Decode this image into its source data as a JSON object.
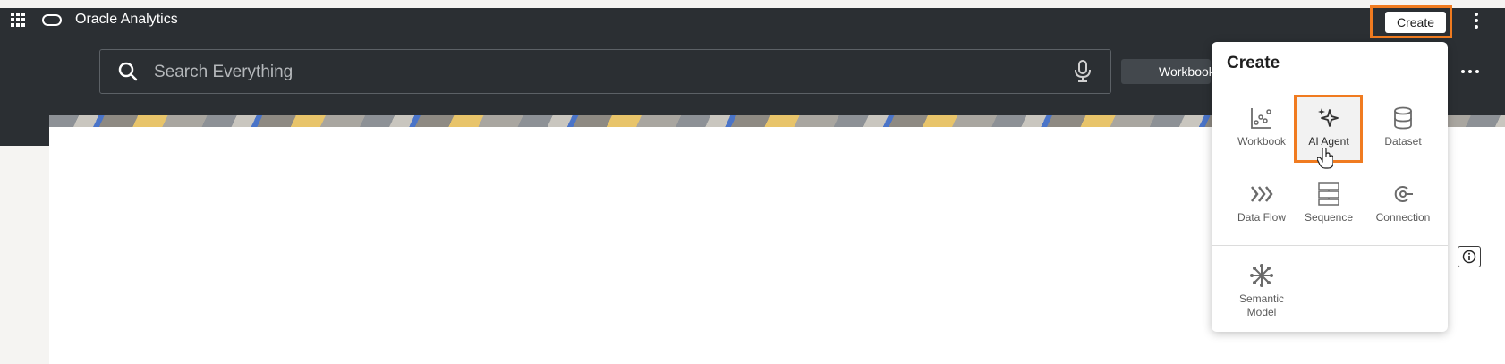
{
  "header": {
    "app_title": "Oracle Analytics",
    "create_label": "Create"
  },
  "search": {
    "placeholder": "Search Everything"
  },
  "filter_chip": {
    "label": "Workbook"
  },
  "create_menu": {
    "title": "Create",
    "items": [
      {
        "label": "Workbook",
        "icon": "workbook-icon"
      },
      {
        "label": "AI Agent",
        "icon": "ai-agent-icon",
        "highlighted": true
      },
      {
        "label": "Dataset",
        "icon": "dataset-icon"
      },
      {
        "label": "Data Flow",
        "icon": "data-flow-icon"
      },
      {
        "label": "Sequence",
        "icon": "sequence-icon"
      },
      {
        "label": "Connection",
        "icon": "connection-icon"
      },
      {
        "label": "Semantic Model",
        "icon": "semantic-model-icon"
      }
    ]
  },
  "colors": {
    "topbar": "#2b2f33",
    "highlight": "#f07b20"
  }
}
